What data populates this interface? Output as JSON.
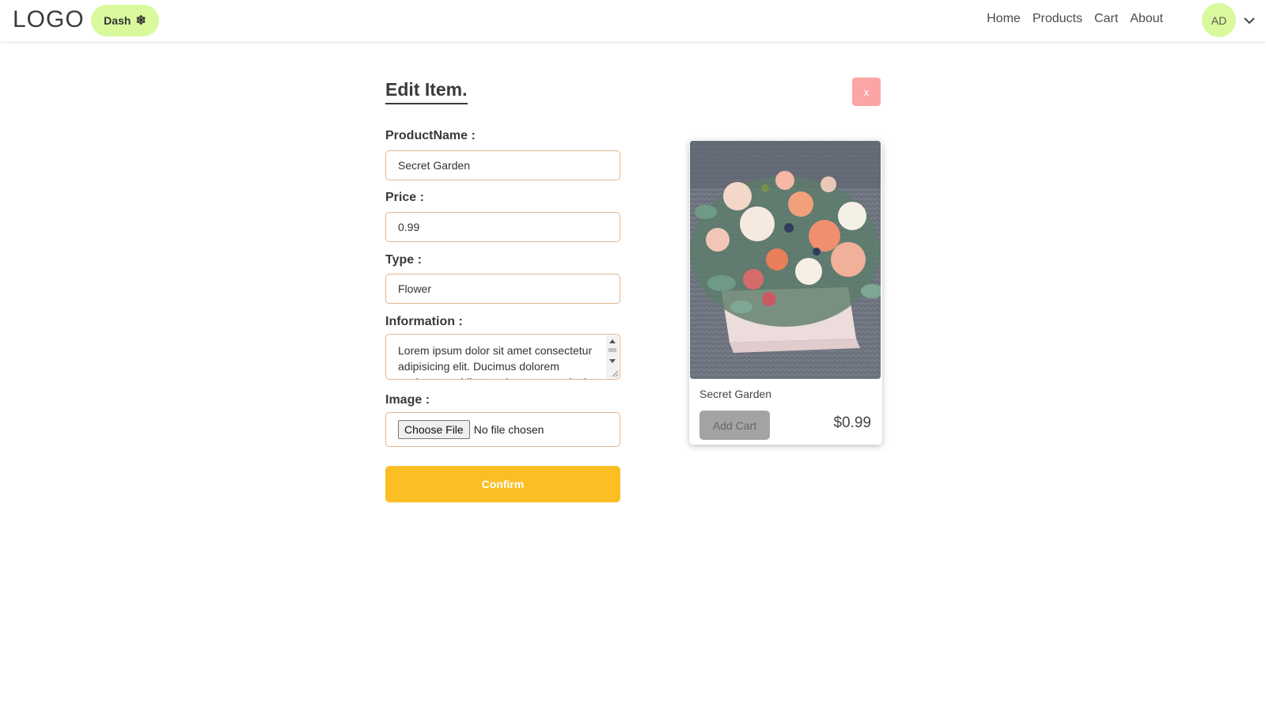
{
  "header": {
    "logo": "LOGO",
    "dash_label": "Dash",
    "nav": [
      "Home",
      "Products",
      "Cart",
      "About"
    ],
    "avatar_initials": "AD"
  },
  "form": {
    "title": "Edit Item.",
    "close_label": "x",
    "fields": {
      "product_name": {
        "label": "ProductName :",
        "value": "Secret Garden"
      },
      "price": {
        "label": "Price :",
        "value": "0.99"
      },
      "type": {
        "label": "Type :",
        "value": "Flower"
      },
      "information": {
        "label": "Information :",
        "value": "Lorem ipsum dolor sit amet consectetur adipisicing elit. Ducimus dolorem sapiente cupiditate qui cumque veritatis"
      },
      "image": {
        "label": "Image :",
        "button_label": "Choose File",
        "status": "No file chosen"
      }
    },
    "confirm_label": "Confirm"
  },
  "card": {
    "name": "Secret Garden",
    "add_cart_label": "Add Cart",
    "price": "$0.99"
  },
  "colors": {
    "accent_lime": "#d9f99d",
    "confirm_yellow": "#fbbf24",
    "close_pink": "#fca5a5",
    "field_border": "#e2b48f"
  }
}
